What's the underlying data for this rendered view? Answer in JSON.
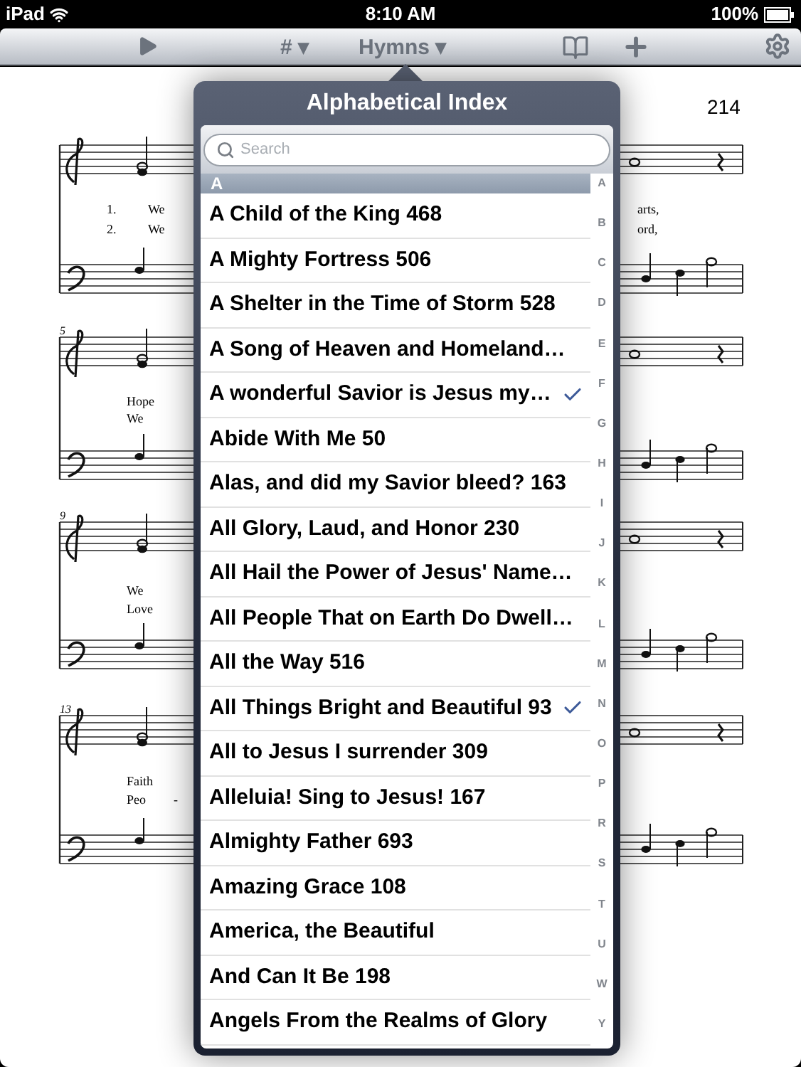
{
  "status_bar": {
    "device": "iPad",
    "time": "8:10 AM",
    "battery": "100%"
  },
  "toolbar": {
    "number_menu": "# ▾",
    "book_menu": "Hymns ▾"
  },
  "score": {
    "page_number": "214",
    "measure_numbers": [
      "5",
      "9",
      "13"
    ],
    "lyrics": [
      "1.",
      "We",
      "2.",
      "We",
      "arts,",
      "ord,",
      "Hope",
      "We",
      "We",
      "Love",
      "Faith",
      "Peo",
      "-"
    ]
  },
  "popover": {
    "title": "Alphabetical Index",
    "search": {
      "placeholder": "Search"
    },
    "section": "A",
    "rows": [
      {
        "title": "A Child of the King 468",
        "checked": false
      },
      {
        "title": "A Mighty Fortress 506",
        "checked": false
      },
      {
        "title": "A Shelter in the Time of Storm 528",
        "checked": false
      },
      {
        "title": "A Song of Heaven and Homeland…",
        "checked": false
      },
      {
        "title": "A wonderful Savior is Jesus my…",
        "checked": true
      },
      {
        "title": "Abide With Me 50",
        "checked": false
      },
      {
        "title": "Alas, and did my Savior bleed? 163",
        "checked": false
      },
      {
        "title": "All Glory, Laud, and Honor 230",
        "checked": false
      },
      {
        "title": "All Hail the Power of Jesus' Name…",
        "checked": false
      },
      {
        "title": "All People That on Earth Do Dwell…",
        "checked": false
      },
      {
        "title": "All the Way 516",
        "checked": false
      },
      {
        "title": "All Things Bright and Beautiful 93",
        "checked": true
      },
      {
        "title": "All to Jesus I surrender 309",
        "checked": false
      },
      {
        "title": "Alleluia! Sing to Jesus! 167",
        "checked": false
      },
      {
        "title": "Almighty Father 693",
        "checked": false
      },
      {
        "title": "Amazing Grace 108",
        "checked": false
      },
      {
        "title": "America, the Beautiful",
        "checked": false
      },
      {
        "title": "And Can It Be 198",
        "checked": false
      },
      {
        "title": "Angels From the Realms of Glory",
        "checked": false
      }
    ],
    "index": [
      "A",
      "B",
      "C",
      "D",
      "E",
      "F",
      "G",
      "H",
      "I",
      "J",
      "K",
      "L",
      "M",
      "N",
      "O",
      "P",
      "R",
      "S",
      "T",
      "U",
      "W",
      "Y"
    ]
  }
}
